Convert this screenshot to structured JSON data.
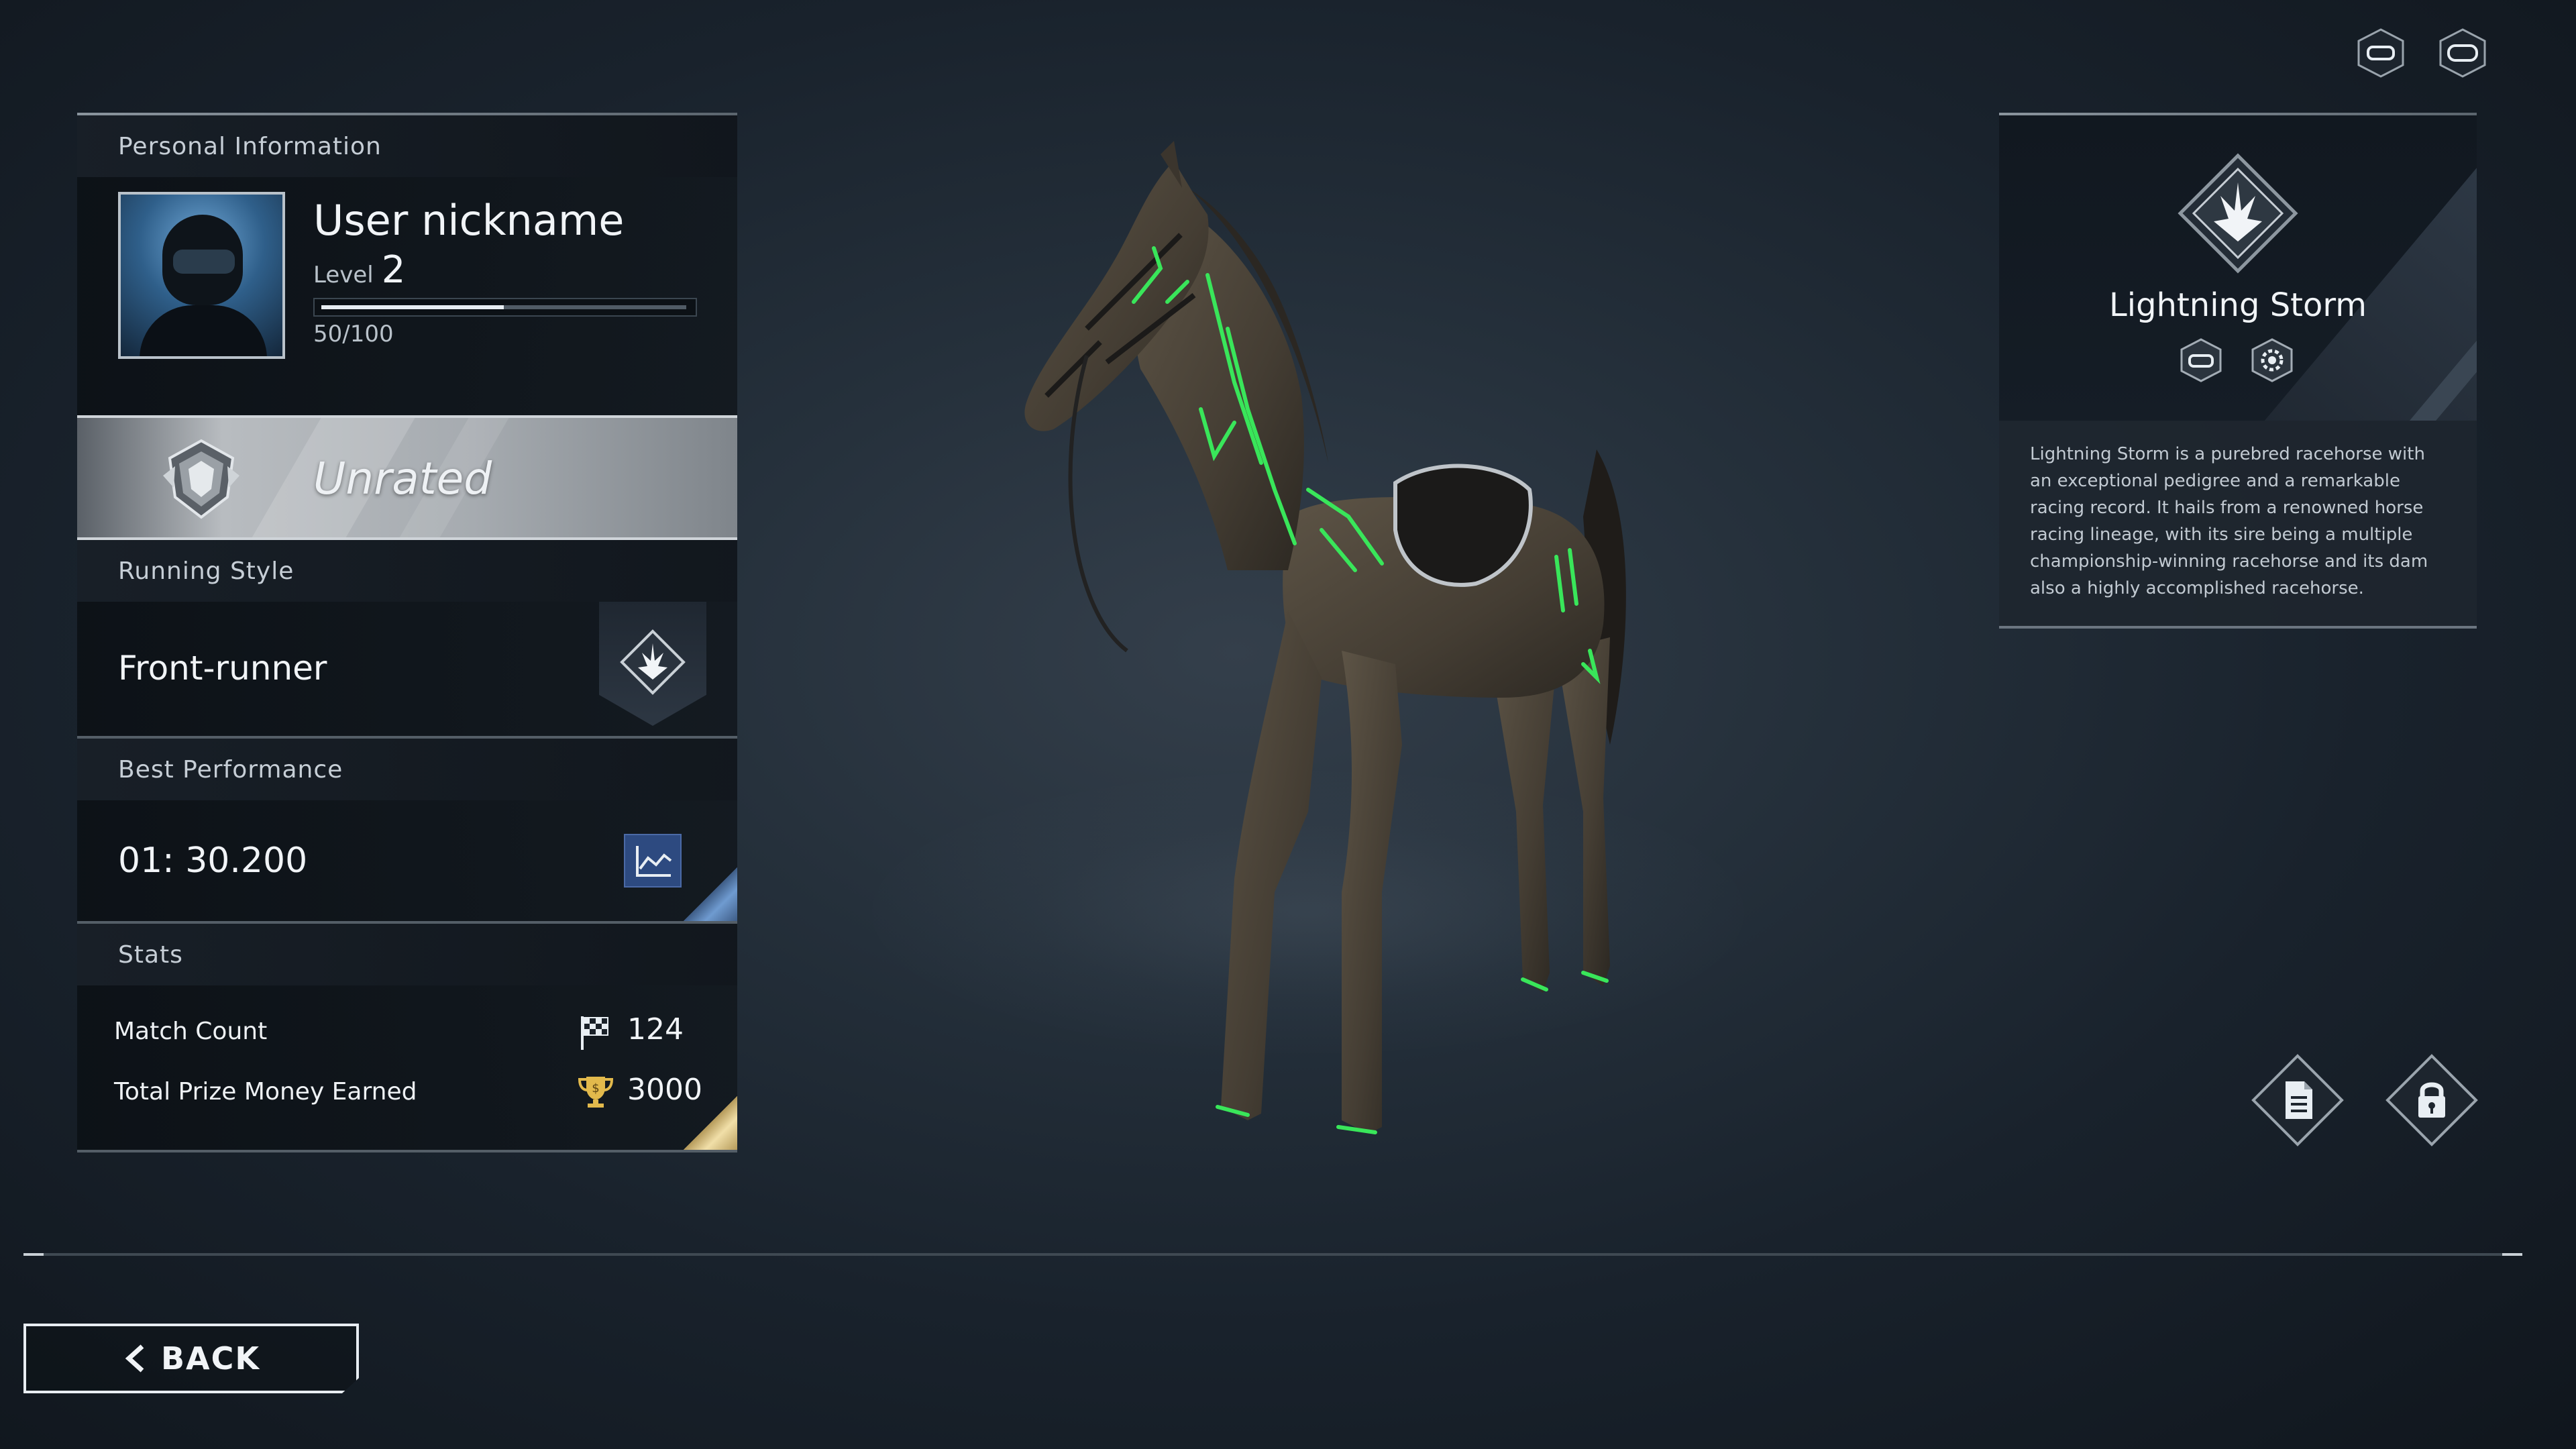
{
  "profile": {
    "section_title": "Personal Information",
    "nickname": "User nickname",
    "level_label": "Level",
    "level": "2",
    "xp_text": "50/100",
    "xp_progress": 0.5
  },
  "rank": {
    "label": "Unrated"
  },
  "running_style": {
    "section_title": "Running Style",
    "value": "Front-runner"
  },
  "best_performance": {
    "section_title": "Best Performance",
    "time": "01: 30.200"
  },
  "stats": {
    "section_title": "Stats",
    "items": [
      {
        "label": "Match Count",
        "icon": "checkered-flag-icon",
        "value": "124"
      },
      {
        "label": "Total Prize Money Earned",
        "icon": "trophy-icon",
        "value": "3000"
      }
    ]
  },
  "horse": {
    "name": "Lightning Storm",
    "description": "Lightning Storm is a purebred racehorse with an exceptional pedigree and a remarkable racing record. It hails from a renowned horse racing lineage, with its sire being a multiple championship-winning racehorse and its dam also a highly accomplished racehorse.",
    "accent_color": "#39e65a"
  },
  "top_icons": [
    "hmd-icon",
    "vr-headset-icon"
  ],
  "actions": [
    "document-icon",
    "lock-icon"
  ],
  "back_label": "BACK"
}
